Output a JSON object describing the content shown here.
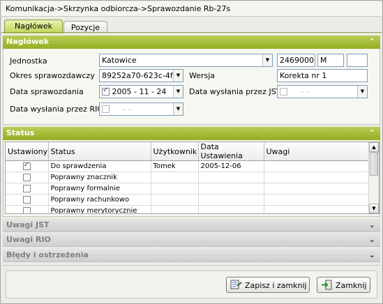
{
  "window": {
    "title": "Komunikacja->Skrzynka  odbiorcza->Sprawozdanie  Rb-27s"
  },
  "tabs": [
    {
      "label": "Nagłówek"
    },
    {
      "label": "Pozycje"
    }
  ],
  "header": {
    "title": "Nagłówek",
    "jednostka_label": "Jednostka",
    "jednostka_value": "Katowice",
    "jednostka_code": "2469000",
    "jednostka_type": "M",
    "jednostka_extra": "",
    "okres_label": "Okres sprawozdawczy",
    "okres_value": "89252a70-623c-4f",
    "wersja_label": "Wersja",
    "wersja_value": "Korekta nr 1",
    "data_spraw_label": "Data sprawozdania",
    "data_spraw_value": "2005 - 11 - 24",
    "data_spraw_checked": true,
    "data_jst_label": "Data wysłania przez JST",
    "data_jst_value": "-       -",
    "data_rio_label": "Data wysłania przez RIO",
    "data_rio_value": "-       -"
  },
  "status": {
    "title": "Status",
    "columns": [
      "Ustawiony",
      "Status",
      "Użytkownik",
      "Data Ustawienia",
      "Uwagi"
    ],
    "rows": [
      {
        "checked": true,
        "status": "Do sprawdzenia",
        "user": "Tomek",
        "date": "2005-12-06",
        "notes": ""
      },
      {
        "checked": false,
        "status": "Poprawny znacznik",
        "user": "",
        "date": "",
        "notes": ""
      },
      {
        "checked": false,
        "status": "Poprawny formalnie",
        "user": "",
        "date": "",
        "notes": ""
      },
      {
        "checked": false,
        "status": "Poprawny rachunkowo",
        "user": "",
        "date": "",
        "notes": ""
      },
      {
        "checked": false,
        "status": "Poprawny merytorycznie",
        "user": "",
        "date": "",
        "notes": ""
      }
    ]
  },
  "collapsed": [
    {
      "title": "Uwagi JST"
    },
    {
      "title": "Uwagi RIO"
    },
    {
      "title": "Błędy i ostrzeżenia"
    }
  ],
  "buttons": {
    "save_close": "Zapisz i zamknij",
    "close": "Zamknij"
  },
  "icons": {
    "expand": "chevron-up-icon",
    "collapse": "chevron-down-icon"
  },
  "colors": {
    "accent": "#9db52e",
    "accent_light": "#e0ecaa"
  }
}
